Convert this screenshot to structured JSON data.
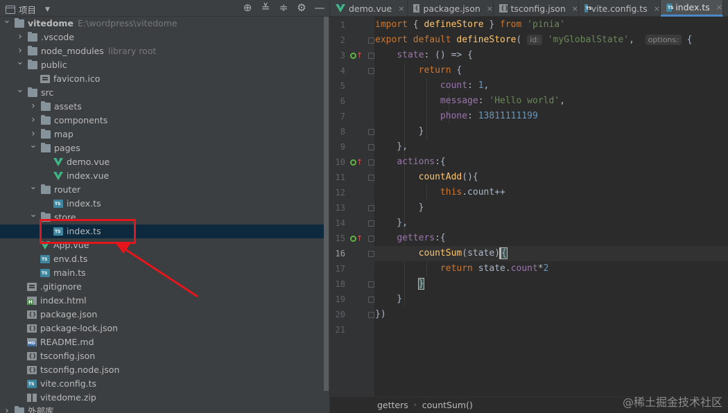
{
  "project_panel": {
    "title": "项目",
    "tools": [
      "locate-icon",
      "collapse-all-icon",
      "expand-icon",
      "gear-icon",
      "minimize-icon"
    ]
  },
  "tree": [
    {
      "depth": 0,
      "arrow": "down",
      "icon": "folder",
      "label": "vitedome",
      "hint": "E:\\wordpress\\vitedome",
      "bold": true
    },
    {
      "depth": 1,
      "arrow": "right",
      "icon": "folder",
      "label": ".vscode"
    },
    {
      "depth": 1,
      "arrow": "right",
      "icon": "folder",
      "label": "node_modules",
      "hint": "library root"
    },
    {
      "depth": 1,
      "arrow": "down",
      "icon": "folder",
      "label": "public"
    },
    {
      "depth": 2,
      "arrow": "",
      "icon": "file",
      "label": "favicon.ico"
    },
    {
      "depth": 1,
      "arrow": "down",
      "icon": "folder",
      "label": "src"
    },
    {
      "depth": 2,
      "arrow": "right",
      "icon": "folder",
      "label": "assets"
    },
    {
      "depth": 2,
      "arrow": "right",
      "icon": "folder",
      "label": "components"
    },
    {
      "depth": 2,
      "arrow": "right",
      "icon": "folder",
      "label": "map"
    },
    {
      "depth": 2,
      "arrow": "down",
      "icon": "folder",
      "label": "pages"
    },
    {
      "depth": 3,
      "arrow": "",
      "icon": "vue",
      "label": "demo.vue"
    },
    {
      "depth": 3,
      "arrow": "",
      "icon": "vue",
      "label": "index.vue"
    },
    {
      "depth": 2,
      "arrow": "down",
      "icon": "folder",
      "label": "router"
    },
    {
      "depth": 3,
      "arrow": "",
      "icon": "ts",
      "label": "index.ts"
    },
    {
      "depth": 2,
      "arrow": "down",
      "icon": "folder",
      "label": "store"
    },
    {
      "depth": 3,
      "arrow": "",
      "icon": "ts",
      "label": "index.ts",
      "selected": true
    },
    {
      "depth": 2,
      "arrow": "",
      "icon": "vue",
      "label": "App.vue"
    },
    {
      "depth": 2,
      "arrow": "",
      "icon": "ts",
      "label": "env.d.ts"
    },
    {
      "depth": 2,
      "arrow": "",
      "icon": "ts",
      "label": "main.ts"
    },
    {
      "depth": 1,
      "arrow": "",
      "icon": "file",
      "label": ".gitignore"
    },
    {
      "depth": 1,
      "arrow": "",
      "icon": "html",
      "label": "index.html"
    },
    {
      "depth": 1,
      "arrow": "",
      "icon": "json",
      "label": "package.json"
    },
    {
      "depth": 1,
      "arrow": "",
      "icon": "json",
      "label": "package-lock.json"
    },
    {
      "depth": 1,
      "arrow": "",
      "icon": "md",
      "label": "README.md"
    },
    {
      "depth": 1,
      "arrow": "",
      "icon": "json",
      "label": "tsconfig.json"
    },
    {
      "depth": 1,
      "arrow": "",
      "icon": "json",
      "label": "tsconfig.node.json"
    },
    {
      "depth": 1,
      "arrow": "",
      "icon": "ts",
      "label": "vite.config.ts"
    },
    {
      "depth": 1,
      "arrow": "",
      "icon": "zip",
      "label": "vitedome.zip"
    },
    {
      "depth": 0,
      "arrow": "right",
      "icon": "lib",
      "label": "外部库"
    }
  ],
  "tabs": [
    {
      "label": "demo.vue",
      "icon": "vue"
    },
    {
      "label": "package.json",
      "icon": "json"
    },
    {
      "label": "tsconfig.json",
      "icon": "json"
    },
    {
      "label": "vite.config.ts",
      "icon": "ts"
    },
    {
      "label": "index.ts",
      "icon": "ts",
      "active": true
    }
  ],
  "code": [
    [
      [
        "kw",
        "import"
      ],
      [
        "plain",
        " { "
      ],
      [
        "fn",
        "defineStore"
      ],
      [
        "plain",
        " } "
      ],
      [
        "kw",
        "from"
      ],
      [
        "plain",
        " "
      ],
      [
        "str",
        "'pinia'"
      ]
    ],
    [
      [
        "kw",
        "export default "
      ],
      [
        "fn",
        "defineStore"
      ],
      [
        "plain",
        "( "
      ],
      [
        "hint",
        "id:"
      ],
      [
        "plain",
        " "
      ],
      [
        "str",
        "'myGlobalState'"
      ],
      [
        "plain",
        ",  "
      ],
      [
        "hint",
        "options:"
      ],
      [
        "plain",
        " {"
      ]
    ],
    [
      [
        "plain",
        "    "
      ],
      [
        "prop",
        "state"
      ],
      [
        "plain",
        ": () => {"
      ]
    ],
    [
      [
        "plain",
        "        "
      ],
      [
        "kw",
        "return"
      ],
      [
        "plain",
        " {"
      ]
    ],
    [
      [
        "plain",
        "            "
      ],
      [
        "prop",
        "count"
      ],
      [
        "plain",
        ": "
      ],
      [
        "num",
        "1"
      ],
      [
        "plain",
        ","
      ]
    ],
    [
      [
        "plain",
        "            "
      ],
      [
        "prop",
        "message"
      ],
      [
        "plain",
        ": "
      ],
      [
        "str",
        "'Hello world'"
      ],
      [
        "plain",
        ","
      ]
    ],
    [
      [
        "plain",
        "            "
      ],
      [
        "prop",
        "phone"
      ],
      [
        "plain",
        ": "
      ],
      [
        "num",
        "13811111199"
      ]
    ],
    [
      [
        "plain",
        "        }"
      ]
    ],
    [
      [
        "plain",
        "    },"
      ]
    ],
    [
      [
        "plain",
        "    "
      ],
      [
        "prop",
        "actions"
      ],
      [
        "plain",
        ":{"
      ]
    ],
    [
      [
        "plain",
        "        "
      ],
      [
        "fn",
        "countAdd"
      ],
      [
        "plain",
        "(){"
      ]
    ],
    [
      [
        "plain",
        "            "
      ],
      [
        "kw",
        "this"
      ],
      [
        "plain",
        ".count++"
      ]
    ],
    [
      [
        "plain",
        "        }"
      ]
    ],
    [
      [
        "plain",
        "    },"
      ]
    ],
    [
      [
        "plain",
        "    "
      ],
      [
        "prop",
        "getters"
      ],
      [
        "plain",
        ":{"
      ]
    ],
    [
      [
        "plain",
        "        "
      ],
      [
        "fn",
        "countSum"
      ],
      [
        "plain",
        "(state)"
      ],
      [
        "match",
        "{"
      ]
    ],
    [
      [
        "plain",
        "            "
      ],
      [
        "kw",
        "return"
      ],
      [
        "plain",
        " state."
      ],
      [
        "prop",
        "count"
      ],
      [
        "plain",
        "*"
      ],
      [
        "num",
        "2"
      ]
    ],
    [
      [
        "plain",
        "        "
      ],
      [
        "match",
        "}"
      ]
    ],
    [
      [
        "plain",
        "    }"
      ]
    ],
    [
      [
        "plain",
        "})"
      ]
    ],
    [
      [
        "plain",
        ""
      ]
    ]
  ],
  "current_line": 16,
  "line_numbers": [
    "1",
    "2",
    "3",
    "4",
    "5",
    "6",
    "7",
    "8",
    "9",
    "10",
    "11",
    "12",
    "13",
    "14",
    "15",
    "16",
    "17",
    "18",
    "19",
    "20",
    "21"
  ],
  "breadcrumb": [
    "getters",
    "countSum()"
  ],
  "watermark": "@稀土掘金技术社区",
  "colors": {
    "selection": "#0d293e",
    "annotation": "#e5161b",
    "active_tab_underline": "#4a88c7"
  }
}
